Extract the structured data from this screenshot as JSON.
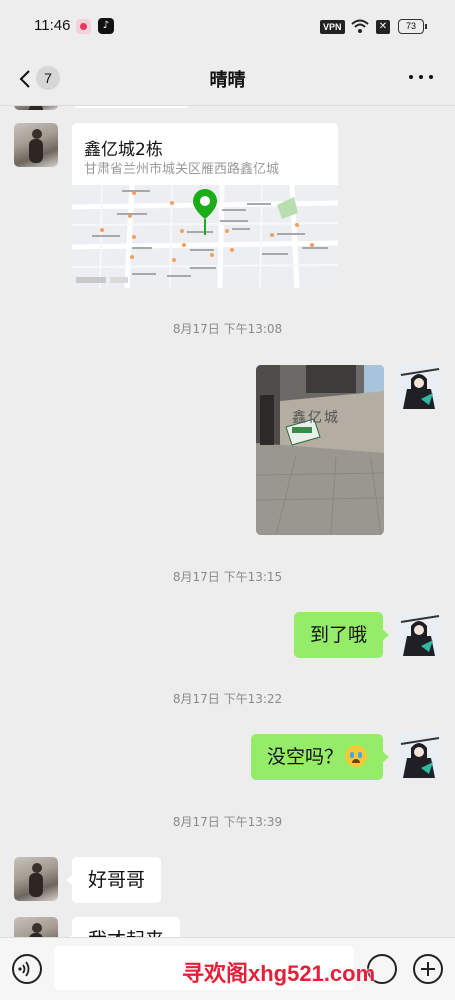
{
  "status_bar": {
    "time": "11:46",
    "vpn_label": "VPN",
    "battery": "73"
  },
  "header": {
    "unread_count": "7",
    "title": "晴晴"
  },
  "messages": {
    "location": {
      "name": "鑫亿城2栋",
      "address": "甘肃省兰州市城关区雁西路鑫亿城"
    },
    "timestamp_1": "8月17日 下午13:08",
    "photo_sign_text": "鑫亿城",
    "timestamp_2": "8月17日 下午13:15",
    "msg_arrived": "到了哦",
    "timestamp_3": "8月17日 下午13:22",
    "msg_free": "没空吗？",
    "timestamp_4": "8月17日 下午13:39",
    "msg_brother": "好哥哥",
    "msg_partial": "我才起来"
  },
  "input_bar": {
    "placeholder": ""
  },
  "watermark": "寻欢阁xhg521.com",
  "colors": {
    "background": "#ededed",
    "bubble_sent": "#95ec69",
    "bubble_received": "#ffffff",
    "map_pin": "#1aad19"
  }
}
